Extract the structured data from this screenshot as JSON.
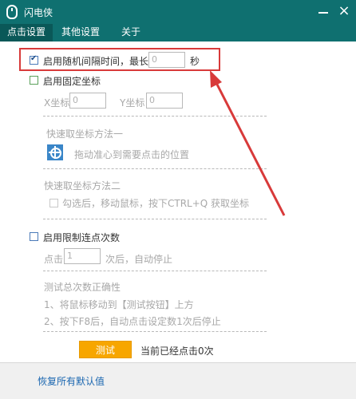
{
  "window": {
    "title": "闪电侠"
  },
  "tabs": [
    {
      "label": "点击设置",
      "active": true
    },
    {
      "label": "其他设置",
      "active": false
    },
    {
      "label": "关于",
      "active": false
    }
  ],
  "random_interval": {
    "label": "启用随机间隔时间，最长为",
    "value": "0",
    "unit": "秒",
    "checked": true
  },
  "fixed_coords": {
    "label": "启用固定坐标",
    "checked": false,
    "x_label": "X坐标",
    "x_value": "0",
    "y_label": "Y坐标",
    "y_value": "0",
    "method1_title": "快速取坐标方法一",
    "method1_desc": "拖动准心到需要点击的位置",
    "method2_title": "快速取坐标方法二",
    "method2_desc": "勾选后，移动鼠标，按下CTRL+Q 获取坐标"
  },
  "limit_clicks": {
    "label": "启用限制连点次数",
    "checked": false,
    "prefix": "点击",
    "value": "1",
    "suffix": "次后，自动停止"
  },
  "test": {
    "title": "测试总次数正确性",
    "step1": "1、将鼠标移动到【测试按钮】上方",
    "step2": "2、按下F8后，自动点击设定数1次后停止",
    "button_label": "测试",
    "status": "当前已经点击0次"
  },
  "footer": {
    "reset_label": "恢复所有默认值"
  },
  "colors": {
    "titlebar": "#0f7070",
    "accent": "#f7a600",
    "highlight": "#d83a3a",
    "link": "#1a66b0"
  }
}
